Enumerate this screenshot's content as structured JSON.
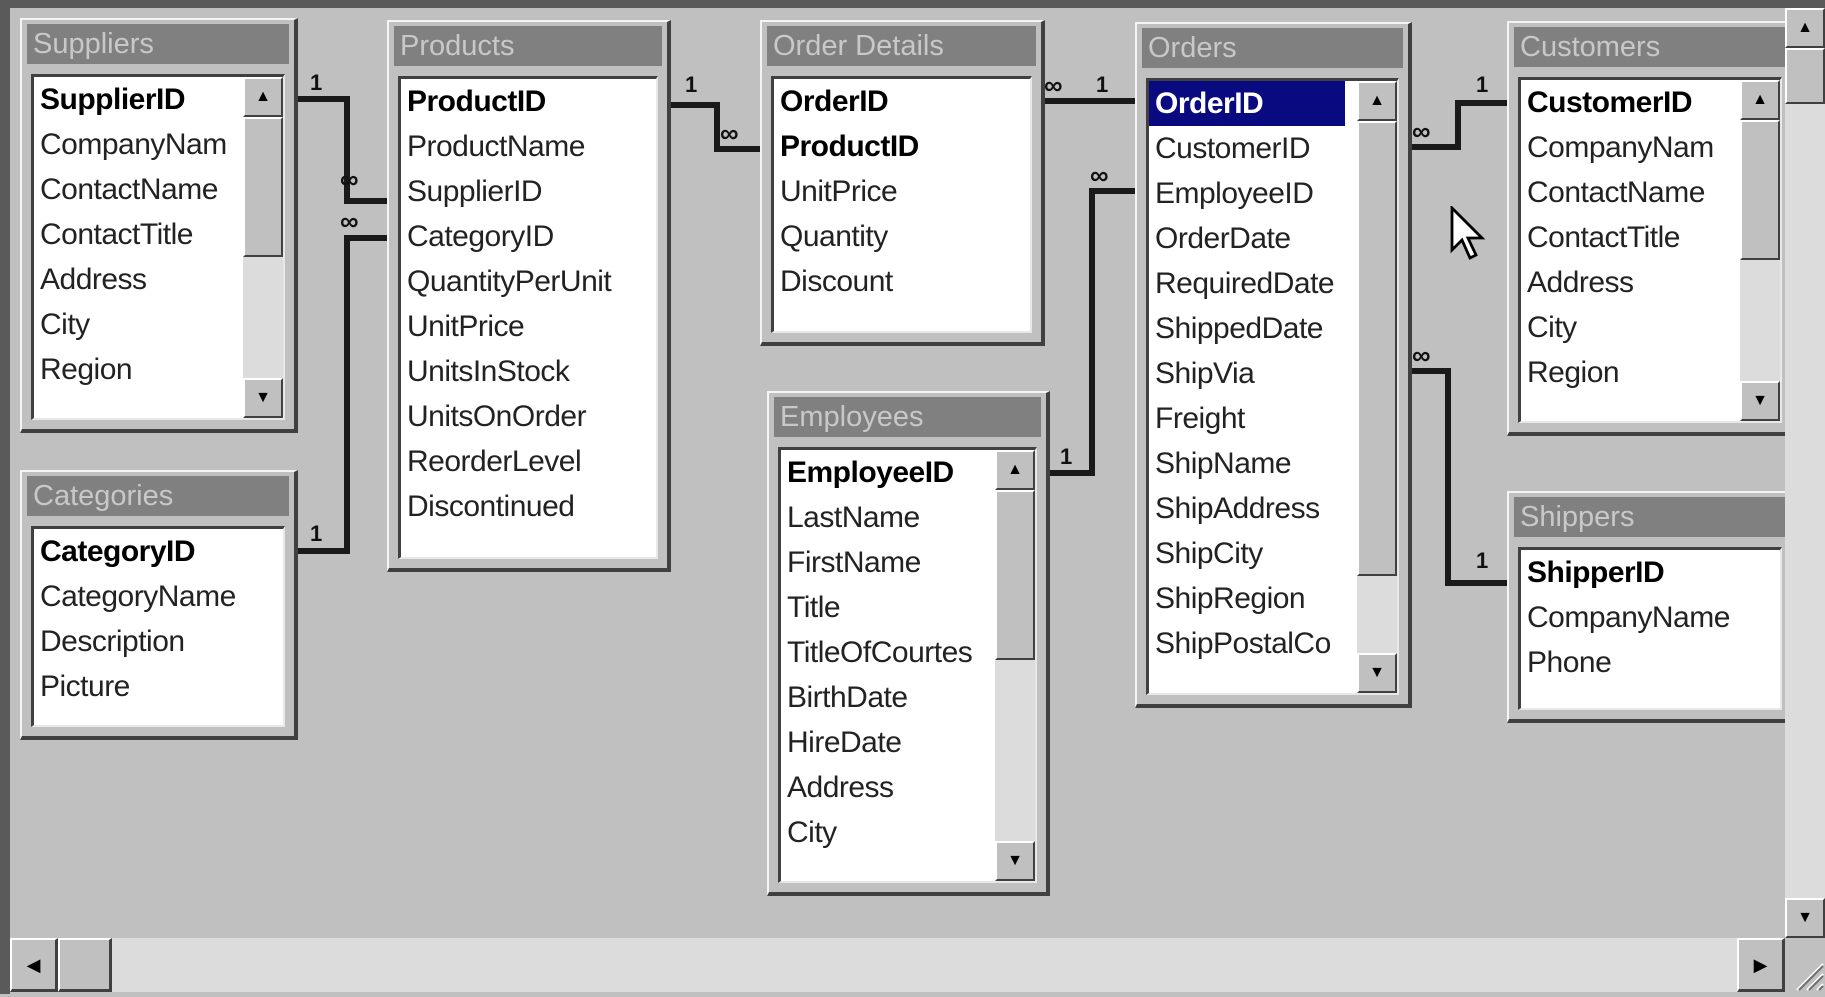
{
  "tables": {
    "suppliers": {
      "title": "Suppliers",
      "fields": [
        "SupplierID",
        "CompanyNam",
        "ContactName",
        "ContactTitle",
        "Address",
        "City",
        "Region"
      ]
    },
    "categories": {
      "title": "Categories",
      "fields": [
        "CategoryID",
        "CategoryName",
        "Description",
        "Picture"
      ]
    },
    "products": {
      "title": "Products",
      "fields": [
        "ProductID",
        "ProductName",
        "SupplierID",
        "CategoryID",
        "QuantityPerUnit",
        "UnitPrice",
        "UnitsInStock",
        "UnitsOnOrder",
        "ReorderLevel",
        "Discontinued"
      ]
    },
    "order_details": {
      "title": "Order Details",
      "fields": [
        "OrderID",
        "ProductID",
        "UnitPrice",
        "Quantity",
        "Discount"
      ]
    },
    "employees": {
      "title": "Employees",
      "fields": [
        "EmployeeID",
        "LastName",
        "FirstName",
        "Title",
        "TitleOfCourtes",
        "BirthDate",
        "HireDate",
        "Address",
        "City"
      ]
    },
    "orders": {
      "title": "Orders",
      "fields": [
        "OrderID",
        "CustomerID",
        "EmployeeID",
        "OrderDate",
        "RequiredDate",
        "ShippedDate",
        "ShipVia",
        "Freight",
        "ShipName",
        "ShipAddress",
        "ShipCity",
        "ShipRegion",
        "ShipPostalCo"
      ]
    },
    "customers": {
      "title": "Customers",
      "fields": [
        "CustomerID",
        "CompanyNam",
        "ContactName",
        "ContactTitle",
        "Address",
        "City",
        "Region"
      ]
    },
    "shippers": {
      "title": "Shippers",
      "fields": [
        "ShipperID",
        "CompanyName",
        "Phone"
      ]
    }
  },
  "cardinality": {
    "one": "1",
    "many": "∞"
  },
  "icons": {
    "scroll_up": "up-arrow-icon",
    "scroll_down": "down-arrow-icon",
    "scroll_left": "left-arrow-icon",
    "scroll_right": "right-arrow-icon",
    "cursor": "mouse-pointer-icon"
  }
}
